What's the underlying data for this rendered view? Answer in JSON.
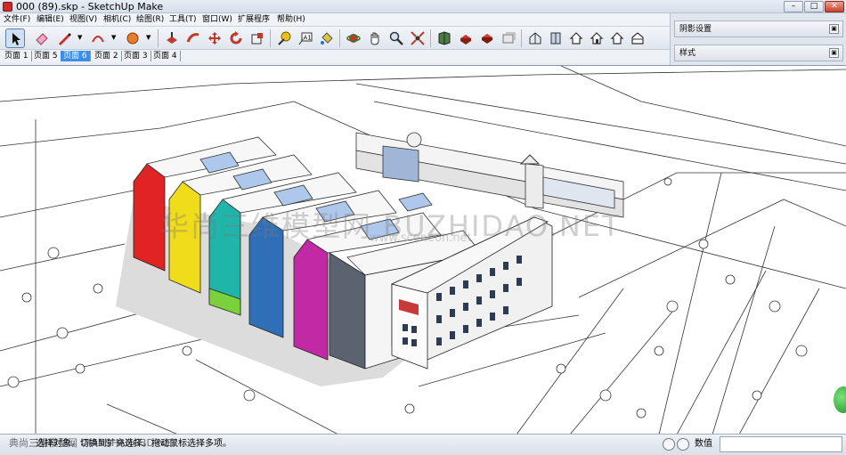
{
  "window": {
    "title": "000 (89).skp - SketchUp Make",
    "controls": {
      "minimize": "–",
      "maximize": "□",
      "close": "✕"
    }
  },
  "menu": {
    "items": [
      {
        "name": "file",
        "label": "文件(F)"
      },
      {
        "name": "edit",
        "label": "编辑(E)"
      },
      {
        "name": "view",
        "label": "视图(V)"
      },
      {
        "name": "camera",
        "label": "相机(C)"
      },
      {
        "name": "draw",
        "label": "绘图(R)"
      },
      {
        "name": "tools",
        "label": "工具(T)"
      },
      {
        "name": "window",
        "label": "窗口(W)"
      },
      {
        "name": "extensions",
        "label": "扩展程序"
      },
      {
        "name": "help",
        "label": "帮助(H)"
      }
    ]
  },
  "toolbar": {
    "tools": [
      {
        "name": "select",
        "icon": "cursor-icon",
        "active": true
      },
      {
        "name": "eraser",
        "icon": "eraser-icon"
      },
      {
        "name": "line",
        "icon": "pencil-icon"
      },
      {
        "name": "arc",
        "icon": "arc-icon"
      },
      {
        "name": "shapes",
        "icon": "circle-icon"
      },
      {
        "name": "push-pull",
        "icon": "push-pull-icon"
      },
      {
        "name": "follow-me",
        "icon": "follow-me-icon"
      },
      {
        "name": "move",
        "icon": "move-icon"
      },
      {
        "name": "rotate",
        "icon": "rotate-icon"
      },
      {
        "name": "scale",
        "icon": "scale-icon"
      },
      {
        "name": "tape-measure",
        "icon": "tape-icon"
      },
      {
        "name": "text",
        "icon": "text-icon"
      },
      {
        "name": "paint-bucket",
        "icon": "paint-bucket-icon"
      },
      {
        "name": "orbit",
        "icon": "orbit-icon"
      },
      {
        "name": "pan",
        "icon": "hand-icon"
      },
      {
        "name": "zoom",
        "icon": "magnifier-icon"
      },
      {
        "name": "zoom-extents",
        "icon": "zoom-extents-icon"
      },
      {
        "name": "3d-warehouse",
        "icon": "warehouse-icon"
      },
      {
        "name": "share-model",
        "icon": "share-icon"
      },
      {
        "name": "extension-warehouse",
        "icon": "extension-icon"
      },
      {
        "name": "layout",
        "icon": "layout-icon"
      },
      {
        "name": "iso-view",
        "icon": "iso-house-icon"
      },
      {
        "name": "top-view",
        "icon": "top-house-icon"
      },
      {
        "name": "front-view",
        "icon": "front-house-icon"
      },
      {
        "name": "right-view",
        "icon": "right-house-icon"
      },
      {
        "name": "back-view",
        "icon": "back-house-icon"
      },
      {
        "name": "left-view",
        "icon": "left-house-icon"
      }
    ]
  },
  "scenes": {
    "tabs": [
      {
        "label": "页面 1",
        "active": false
      },
      {
        "label": "页面 5",
        "active": false
      },
      {
        "label": "页面 6",
        "active": true
      },
      {
        "label": "页面 2",
        "active": false
      },
      {
        "label": "页面 3",
        "active": false
      },
      {
        "label": "页面 4",
        "active": false
      }
    ]
  },
  "tray": {
    "panels": [
      {
        "label": "阴影设置",
        "toggle": "▣"
      },
      {
        "label": "样式",
        "toggle": "▣"
      }
    ]
  },
  "viewport": {
    "watermark": "华尚三维模型网 BUZHIDAO.NET",
    "watermark_sub": "www.sceneon.net",
    "colors": {
      "building_colors": [
        "#e02424",
        "#f0dc1a",
        "#1fb5a9",
        "#2f6fb8",
        "#c22aa5",
        "#7bd13b"
      ],
      "roof": "#f6f6f6",
      "glass": "#b8d3f2",
      "shadow": "#dcdcdc",
      "line": "#333333"
    }
  },
  "status": {
    "overlay_text": "典尚三维模型网 DIANSHANG3D.NET",
    "text": "选择对象。切换到扩充选择。拖动鼠标选择多项。",
    "measurements_label": "数值",
    "measurements_value": ""
  }
}
